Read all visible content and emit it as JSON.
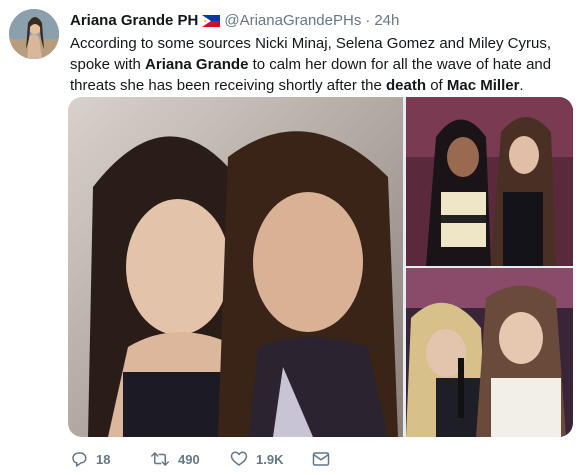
{
  "tweet": {
    "display_name": "Ariana Grande PH",
    "handle": "@ArianaGrandePHs",
    "separator": "·",
    "time": "24h",
    "text": [
      {
        "t": "According to some sources Nicki Minaj, Selena Gomez and Miley Cyrus, spoke with ",
        "b": false
      },
      {
        "t": "Ariana Grande",
        "b": true
      },
      {
        "t": " to calm her down for all the wave of hate and threats she has been receiving shortly after the ",
        "b": false
      },
      {
        "t": "death",
        "b": true
      },
      {
        "t": " of ",
        "b": false
      },
      {
        "t": "Mac Miller",
        "b": true
      },
      {
        "t": ".",
        "b": false
      }
    ]
  },
  "icons": {
    "avatar": "avatar-photo",
    "flag": "philippines-flag-icon",
    "reply": "reply-icon",
    "retweet": "retweet-icon",
    "like": "heart-icon",
    "dm": "envelope-icon"
  },
  "actions": {
    "reply_count": "18",
    "retweet_count": "490",
    "like_count": "1.9K"
  },
  "colors": {
    "text": "#14171a",
    "muted": "#657786",
    "background": "#ffffff"
  }
}
